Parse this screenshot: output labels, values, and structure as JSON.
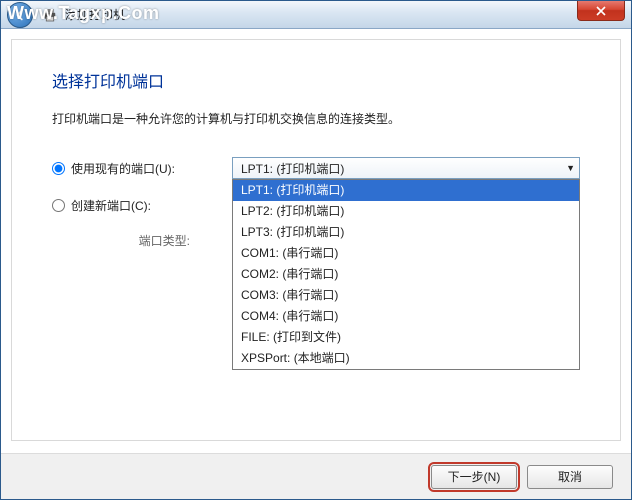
{
  "watermark": "Www.Tagxp.Com",
  "titlebar": {
    "title": "添加打印机"
  },
  "page": {
    "heading": "选择打印机端口",
    "description": "打印机端口是一种允许您的计算机与打印机交换信息的连接类型。"
  },
  "form": {
    "use_existing": {
      "label": "使用现有的端口(U):",
      "checked": true
    },
    "create_new": {
      "label": "创建新端口(C):",
      "checked": false
    },
    "port_type_label": "端口类型:",
    "port_select": {
      "value": "LPT1: (打印机端口)",
      "options": [
        "LPT1: (打印机端口)",
        "LPT2: (打印机端口)",
        "LPT3: (打印机端口)",
        "COM1: (串行端口)",
        "COM2: (串行端口)",
        "COM3: (串行端口)",
        "COM4: (串行端口)",
        "FILE: (打印到文件)",
        "XPSPort: (本地端口)"
      ],
      "selected_index": 0
    }
  },
  "footer": {
    "next": "下一步(N)",
    "cancel": "取消"
  }
}
